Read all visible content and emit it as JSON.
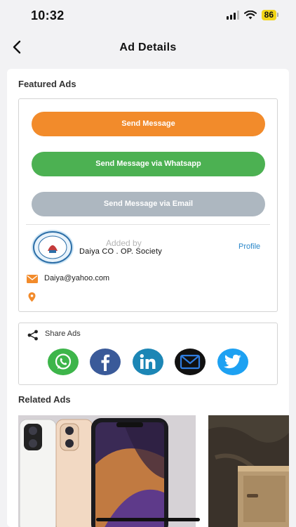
{
  "status_bar": {
    "time": "10:32",
    "battery": "86"
  },
  "nav": {
    "title": "Ad Details"
  },
  "featured": {
    "title": "Featured Ads",
    "send_message": "Send Message",
    "send_whatsapp": "Send Message via Whatsapp",
    "send_email": "Send Message via Email",
    "added_by": "Added by",
    "society_name": "Daiya   CO . OP. Society",
    "profile_link": "Profile",
    "email": "Daiya@yahoo.com"
  },
  "share": {
    "label": "Share Ads",
    "icons": [
      "whatsapp-icon",
      "facebook-icon",
      "linkedin-icon",
      "email-icon",
      "twitter-icon"
    ]
  },
  "related": {
    "title": "Related Ads"
  },
  "colors": {
    "orange": "#f28b2b",
    "green": "#4cb152",
    "grey": "#adb7c0",
    "link": "#2a87c9"
  }
}
